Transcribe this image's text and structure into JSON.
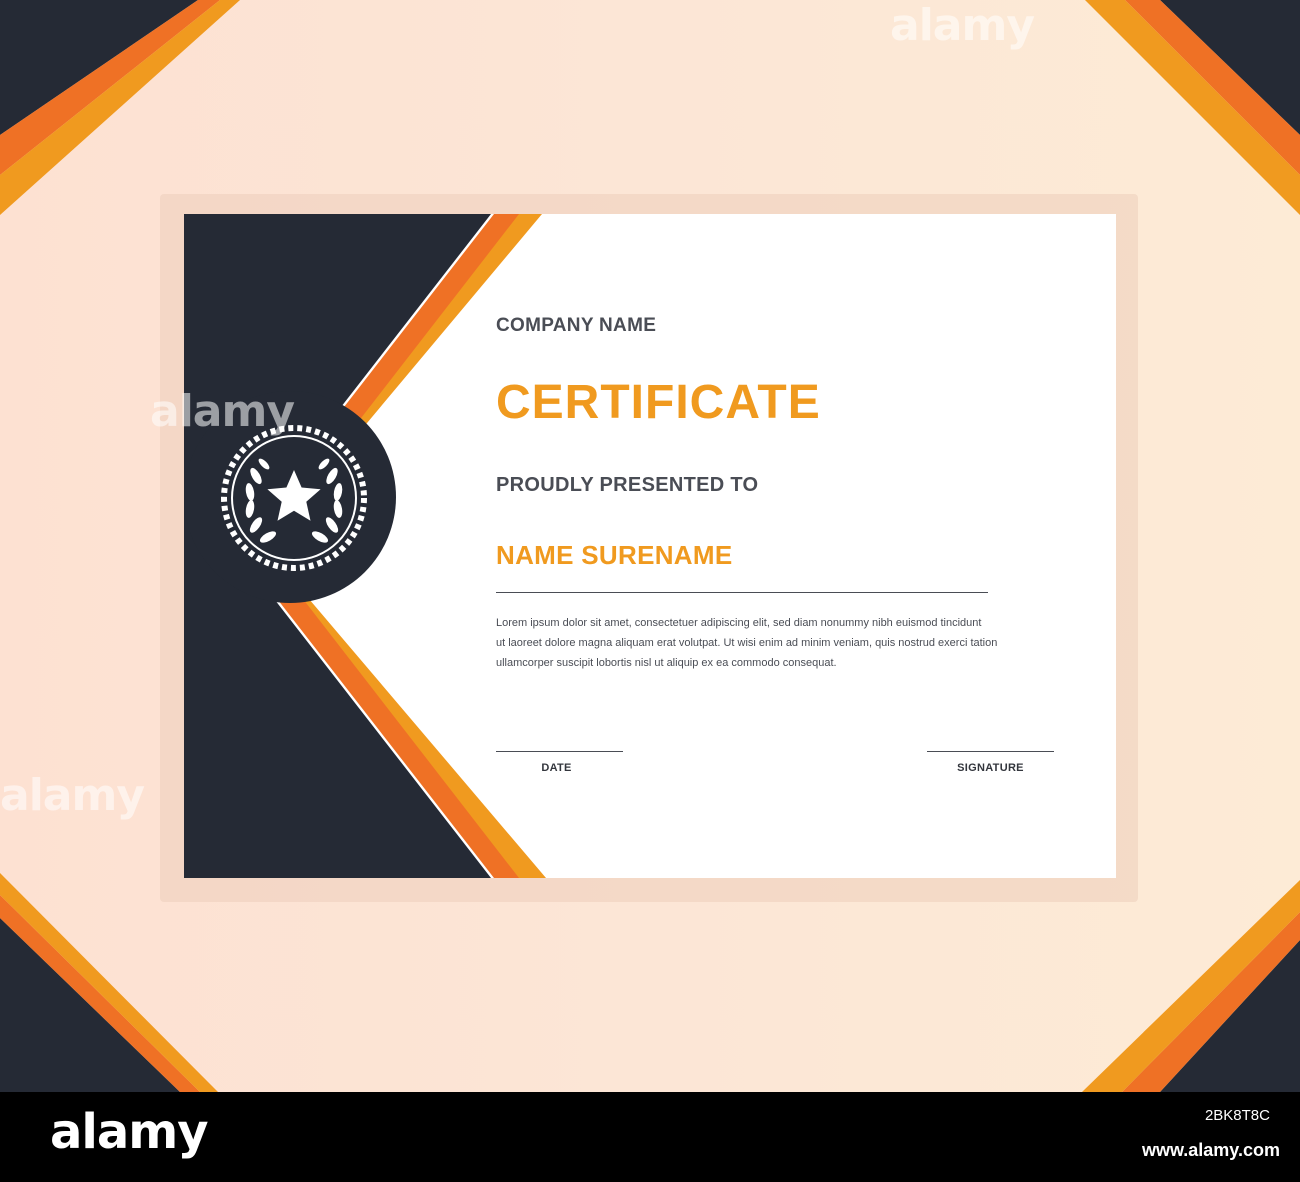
{
  "certificate": {
    "company_name": "COMPANY NAME",
    "title": "CERTIFICATE",
    "presented_to": "PROUDLY PRESENTED TO",
    "recipient_name": "NAME SURENAME",
    "body_lines": [
      "Lorem ipsum dolor sit amet, consectetuer adipiscing elit, sed diam nonummy nibh euismod tincidunt",
      "ut laoreet dolore magna aliquam erat volutpat. Ut wisi enim ad minim veniam, quis nostrud exerci tation",
      "ullamcorper suscipit lobortis nisl ut aliquip ex ea commodo consequat."
    ],
    "date_label": "DATE",
    "signature_label": "SIGNATURE"
  },
  "footer": {
    "logo": "alamy",
    "image_id": "2BK8T8C",
    "url": "www.alamy.com"
  },
  "watermark": {
    "text": "alamy"
  },
  "colors": {
    "navy": "#252a35",
    "orange": "#ef7125",
    "amber": "#f09a1f",
    "background": "#fde4d4",
    "text": "#4a4d55"
  },
  "icons": [
    "laurel-star-emblem-icon"
  ]
}
